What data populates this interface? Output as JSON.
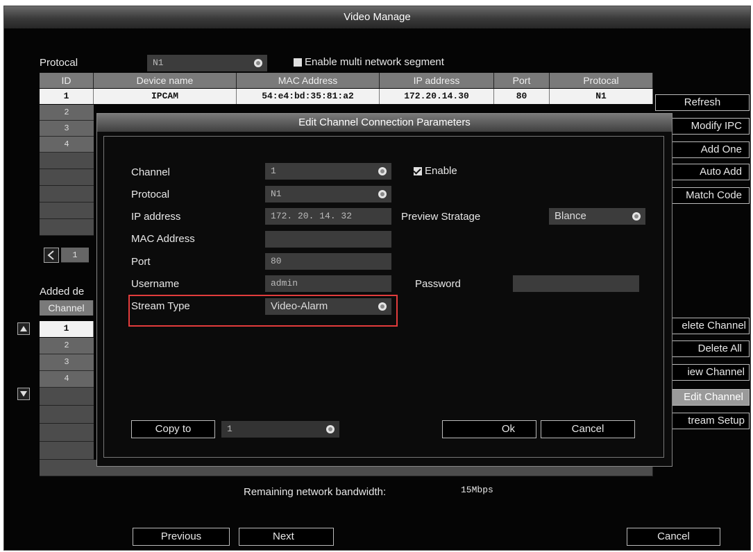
{
  "window": {
    "title": "Video Manage"
  },
  "top_bar": {
    "protocol_label": "Protocal",
    "protocol_value": "N1",
    "multi_segment_label": "Enable multi network segment"
  },
  "device_table": {
    "headers": [
      "ID",
      "Device name",
      "MAC Address",
      "IP address",
      "Port",
      "Protocal"
    ],
    "rows": [
      {
        "id": "1",
        "device_name": "IPCAM",
        "mac": "54:e4:bd:35:81:a2",
        "ip": "172.20.14.30",
        "port": "80",
        "protocol": "N1"
      }
    ],
    "ids": [
      "2",
      "3",
      "4"
    ],
    "pager_value": "1"
  },
  "right_buttons": [
    "Refresh",
    "Modify IPC",
    "Add One",
    "Auto Add",
    "Match Code"
  ],
  "added_devices": {
    "label": "Added de",
    "channel_header": "Channel",
    "channels": [
      "1",
      "2",
      "3",
      "4"
    ]
  },
  "right_buttons_lower": [
    "elete Channel",
    "Delete All",
    "iew Channel",
    "Edit Channel",
    "tream Setup"
  ],
  "bandwidth": {
    "label": "Remaining network bandwidth:",
    "value": "15Mbps"
  },
  "bottom_buttons": {
    "previous": "Previous",
    "next": "Next",
    "cancel": "Cancel"
  },
  "dialog": {
    "title": "Edit Channel Connection Parameters",
    "channel_label": "Channel",
    "channel_value": "1",
    "enable_label": "Enable",
    "protocol_label": "Protocal",
    "protocol_value": "N1",
    "ip_label": "IP address",
    "ip_value": "172. 20. 14. 32",
    "preview_label": "Preview Stratage",
    "preview_value": "Blance",
    "mac_label": "MAC Address",
    "mac_value": "",
    "port_label": "Port",
    "port_value": "80",
    "username_label": "Username",
    "username_value": "admin",
    "password_label": "Password",
    "password_value": "",
    "stream_label": "Stream Type",
    "stream_value": "Video-Alarm",
    "copy_to_label": "Copy to",
    "copy_to_value": "1",
    "ok_label": "Ok",
    "cancel_label": "Cancel"
  },
  "colors": {
    "highlight_box": "#e23c3c",
    "selected_row": "#f2f2f2",
    "window_bg": "#050505"
  }
}
